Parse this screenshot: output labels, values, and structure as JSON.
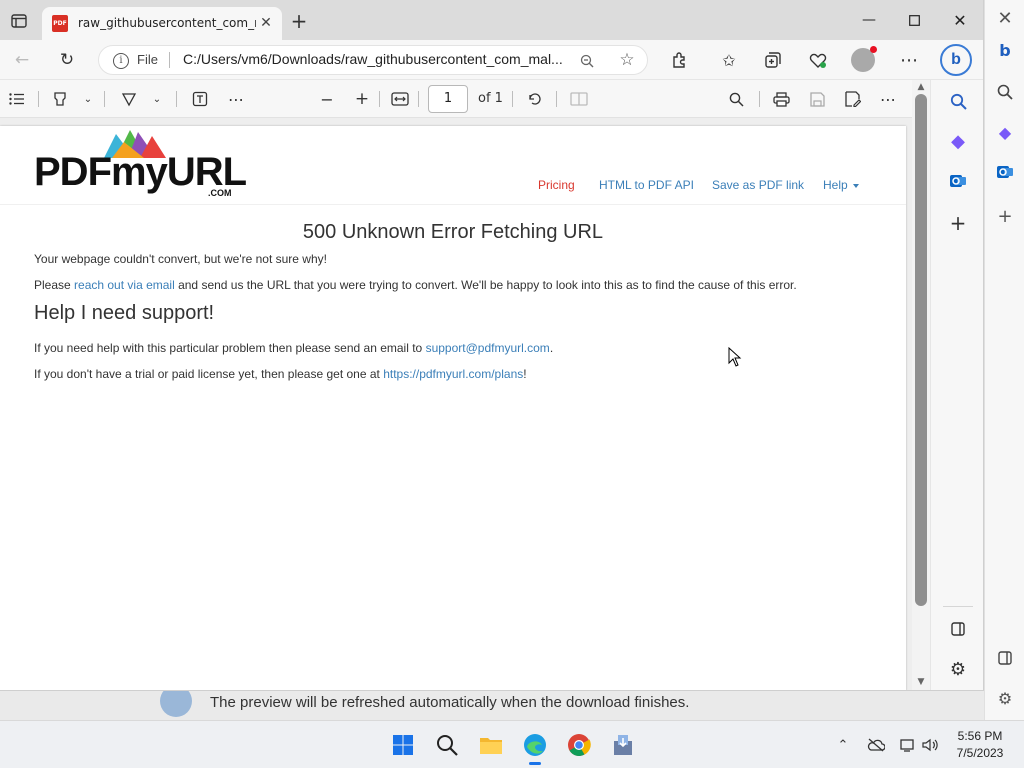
{
  "browser": {
    "tab_title": "raw_githubusercontent_com_mal",
    "tab_icon_text": "PDF",
    "address_scheme": "File",
    "address_url": "C:/Users/vm6/Downloads/raw_githubusercontent_com_mal..."
  },
  "pdf_toolbar": {
    "page_current": "1",
    "page_total": "of 1"
  },
  "page": {
    "logo": "PDFmyURL",
    "logo_suffix": ".COM",
    "menu": [
      "Pricing",
      "HTML to PDF API",
      "Save as PDF link",
      "Help"
    ],
    "error_title": "500 Unknown Error Fetching URL",
    "line1": "Your webpage couldn't convert, but we're not sure why!",
    "line2_prefix": "Please ",
    "line2_link": "reach out via email",
    "line2_suffix": " and send us the URL that you were trying to convert. We'll be happy to look into this as to find the cause of this error.",
    "help_title": "Help I need support!",
    "line3_prefix": "If you need help with this particular problem then please send an email to ",
    "line3_link": "support@pdfmyurl.com",
    "line3_suffix": ".",
    "line4_prefix": "If you don't have a trial or paid license yet, then please get one at ",
    "line4_link": "https://pdfmyurl.com/plans",
    "line4_suffix": "!"
  },
  "background": {
    "download_message": "The preview will be refreshed automatically when the download finishes."
  },
  "taskbar": {
    "time": "5:56 PM",
    "date": "7/5/2023"
  },
  "colors": {
    "link": "#3b7fb8",
    "pricing": "#d9382e",
    "accent": "#1a73e8"
  }
}
